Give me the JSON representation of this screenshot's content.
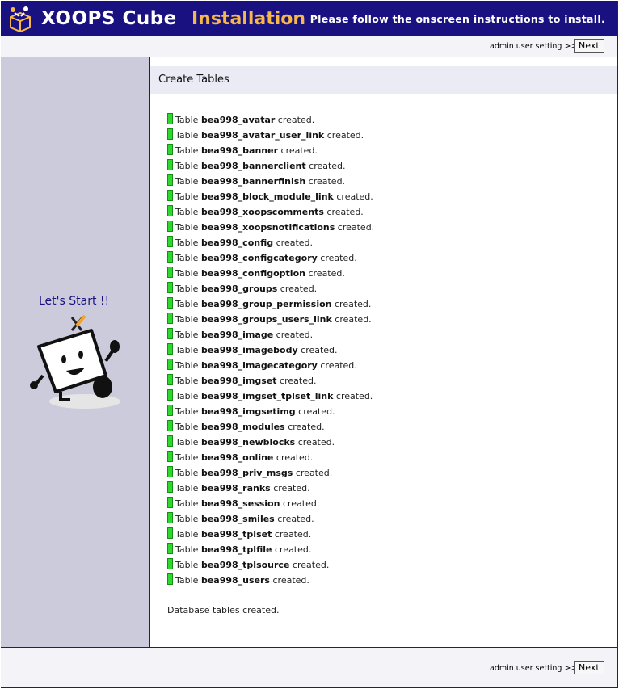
{
  "header": {
    "brand": "XOOPS Cube",
    "title": "Installation",
    "instruction": "Please follow the onscreen instructions to install."
  },
  "nav": {
    "next_hint": "admin user setting >>",
    "next_label": "Next"
  },
  "sidebar": {
    "tagline": "Let's Start !!"
  },
  "main": {
    "title": "Create Tables",
    "prefix": "Table",
    "suffix": "created.",
    "tables": [
      "bea998_avatar",
      "bea998_avatar_user_link",
      "bea998_banner",
      "bea998_bannerclient",
      "bea998_bannerfinish",
      "bea998_block_module_link",
      "bea998_xoopscomments",
      "bea998_xoopsnotifications",
      "bea998_config",
      "bea998_configcategory",
      "bea998_configoption",
      "bea998_groups",
      "bea998_group_permission",
      "bea998_groups_users_link",
      "bea998_image",
      "bea998_imagebody",
      "bea998_imagecategory",
      "bea998_imgset",
      "bea998_imgset_tplset_link",
      "bea998_imgsetimg",
      "bea998_modules",
      "bea998_newblocks",
      "bea998_online",
      "bea998_priv_msgs",
      "bea998_ranks",
      "bea998_session",
      "bea998_smiles",
      "bea998_tplset",
      "bea998_tplfile",
      "bea998_tplsource",
      "bea998_users"
    ],
    "done_message": "Database tables created."
  },
  "footer": {
    "next_hint": "admin user setting >>",
    "next_label": "Next"
  },
  "colors": {
    "header_bg": "#1a1180",
    "accent": "#f6b84a",
    "sidebar_bg": "#cccbdc",
    "success_mark": "#2fd82f"
  }
}
